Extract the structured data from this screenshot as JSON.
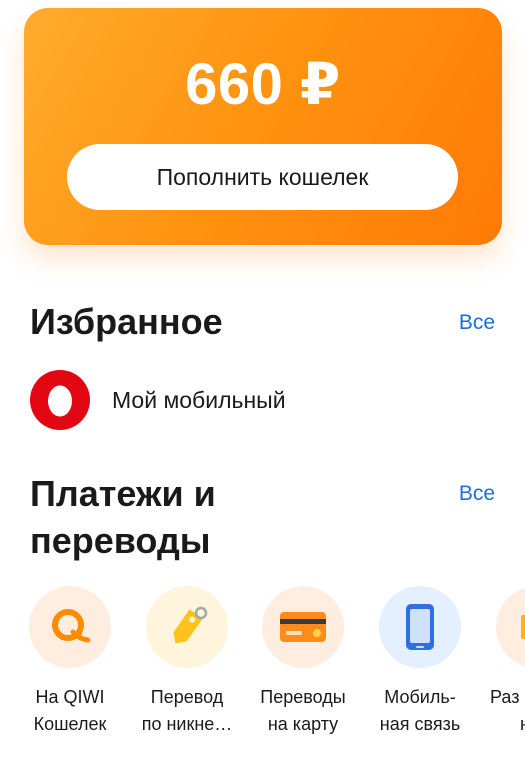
{
  "balance": {
    "amount": "660 ₽",
    "topup_label": "Пополнить кошелек"
  },
  "favorites": {
    "title": "Избранное",
    "see_all": "Все",
    "items": [
      {
        "label": "Мой мобильный",
        "icon": "mts-egg-icon",
        "color": "#e30613"
      }
    ]
  },
  "payments": {
    "title_line1": "Платежи и",
    "title_line2": "переводы",
    "see_all": "Все",
    "services": [
      {
        "line1": "На QIWI",
        "line2": "Кошелек",
        "icon": "qiwi-icon",
        "bg": "#ffeee0"
      },
      {
        "line1": "Перевод",
        "line2": "по никне…",
        "icon": "price-tag-icon",
        "bg": "#fff4dc"
      },
      {
        "line1": "Переводы",
        "line2": "на карту",
        "icon": "bank-card-icon",
        "bg": "#ffeee0"
      },
      {
        "line1": "Мобиль-",
        "line2": "ная связь",
        "icon": "smartphone-icon",
        "bg": "#e4efff"
      },
      {
        "line1": "Раз",
        "line2": "н",
        "icon": "partial-icon",
        "bg": "#ffeee0"
      }
    ]
  },
  "colors": {
    "accent_orange": "#ff9410",
    "link_blue": "#1d6fd2"
  }
}
